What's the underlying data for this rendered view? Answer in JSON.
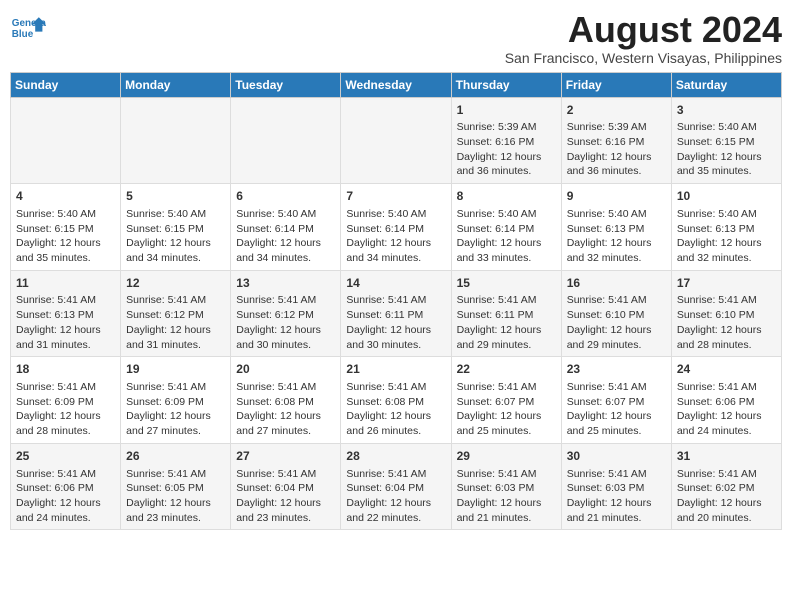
{
  "header": {
    "logo_line1": "General",
    "logo_line2": "Blue",
    "month_year": "August 2024",
    "location": "San Francisco, Western Visayas, Philippines"
  },
  "days_of_week": [
    "Sunday",
    "Monday",
    "Tuesday",
    "Wednesday",
    "Thursday",
    "Friday",
    "Saturday"
  ],
  "weeks": [
    [
      {
        "day": "",
        "content": ""
      },
      {
        "day": "",
        "content": ""
      },
      {
        "day": "",
        "content": ""
      },
      {
        "day": "",
        "content": ""
      },
      {
        "day": "1",
        "content": "Sunrise: 5:39 AM\nSunset: 6:16 PM\nDaylight: 12 hours\nand 36 minutes."
      },
      {
        "day": "2",
        "content": "Sunrise: 5:39 AM\nSunset: 6:16 PM\nDaylight: 12 hours\nand 36 minutes."
      },
      {
        "day": "3",
        "content": "Sunrise: 5:40 AM\nSunset: 6:15 PM\nDaylight: 12 hours\nand 35 minutes."
      }
    ],
    [
      {
        "day": "4",
        "content": "Sunrise: 5:40 AM\nSunset: 6:15 PM\nDaylight: 12 hours\nand 35 minutes."
      },
      {
        "day": "5",
        "content": "Sunrise: 5:40 AM\nSunset: 6:15 PM\nDaylight: 12 hours\nand 34 minutes."
      },
      {
        "day": "6",
        "content": "Sunrise: 5:40 AM\nSunset: 6:14 PM\nDaylight: 12 hours\nand 34 minutes."
      },
      {
        "day": "7",
        "content": "Sunrise: 5:40 AM\nSunset: 6:14 PM\nDaylight: 12 hours\nand 34 minutes."
      },
      {
        "day": "8",
        "content": "Sunrise: 5:40 AM\nSunset: 6:14 PM\nDaylight: 12 hours\nand 33 minutes."
      },
      {
        "day": "9",
        "content": "Sunrise: 5:40 AM\nSunset: 6:13 PM\nDaylight: 12 hours\nand 32 minutes."
      },
      {
        "day": "10",
        "content": "Sunrise: 5:40 AM\nSunset: 6:13 PM\nDaylight: 12 hours\nand 32 minutes."
      }
    ],
    [
      {
        "day": "11",
        "content": "Sunrise: 5:41 AM\nSunset: 6:13 PM\nDaylight: 12 hours\nand 31 minutes."
      },
      {
        "day": "12",
        "content": "Sunrise: 5:41 AM\nSunset: 6:12 PM\nDaylight: 12 hours\nand 31 minutes."
      },
      {
        "day": "13",
        "content": "Sunrise: 5:41 AM\nSunset: 6:12 PM\nDaylight: 12 hours\nand 30 minutes."
      },
      {
        "day": "14",
        "content": "Sunrise: 5:41 AM\nSunset: 6:11 PM\nDaylight: 12 hours\nand 30 minutes."
      },
      {
        "day": "15",
        "content": "Sunrise: 5:41 AM\nSunset: 6:11 PM\nDaylight: 12 hours\nand 29 minutes."
      },
      {
        "day": "16",
        "content": "Sunrise: 5:41 AM\nSunset: 6:10 PM\nDaylight: 12 hours\nand 29 minutes."
      },
      {
        "day": "17",
        "content": "Sunrise: 5:41 AM\nSunset: 6:10 PM\nDaylight: 12 hours\nand 28 minutes."
      }
    ],
    [
      {
        "day": "18",
        "content": "Sunrise: 5:41 AM\nSunset: 6:09 PM\nDaylight: 12 hours\nand 28 minutes."
      },
      {
        "day": "19",
        "content": "Sunrise: 5:41 AM\nSunset: 6:09 PM\nDaylight: 12 hours\nand 27 minutes."
      },
      {
        "day": "20",
        "content": "Sunrise: 5:41 AM\nSunset: 6:08 PM\nDaylight: 12 hours\nand 27 minutes."
      },
      {
        "day": "21",
        "content": "Sunrise: 5:41 AM\nSunset: 6:08 PM\nDaylight: 12 hours\nand 26 minutes."
      },
      {
        "day": "22",
        "content": "Sunrise: 5:41 AM\nSunset: 6:07 PM\nDaylight: 12 hours\nand 25 minutes."
      },
      {
        "day": "23",
        "content": "Sunrise: 5:41 AM\nSunset: 6:07 PM\nDaylight: 12 hours\nand 25 minutes."
      },
      {
        "day": "24",
        "content": "Sunrise: 5:41 AM\nSunset: 6:06 PM\nDaylight: 12 hours\nand 24 minutes."
      }
    ],
    [
      {
        "day": "25",
        "content": "Sunrise: 5:41 AM\nSunset: 6:06 PM\nDaylight: 12 hours\nand 24 minutes."
      },
      {
        "day": "26",
        "content": "Sunrise: 5:41 AM\nSunset: 6:05 PM\nDaylight: 12 hours\nand 23 minutes."
      },
      {
        "day": "27",
        "content": "Sunrise: 5:41 AM\nSunset: 6:04 PM\nDaylight: 12 hours\nand 23 minutes."
      },
      {
        "day": "28",
        "content": "Sunrise: 5:41 AM\nSunset: 6:04 PM\nDaylight: 12 hours\nand 22 minutes."
      },
      {
        "day": "29",
        "content": "Sunrise: 5:41 AM\nSunset: 6:03 PM\nDaylight: 12 hours\nand 21 minutes."
      },
      {
        "day": "30",
        "content": "Sunrise: 5:41 AM\nSunset: 6:03 PM\nDaylight: 12 hours\nand 21 minutes."
      },
      {
        "day": "31",
        "content": "Sunrise: 5:41 AM\nSunset: 6:02 PM\nDaylight: 12 hours\nand 20 minutes."
      }
    ]
  ]
}
